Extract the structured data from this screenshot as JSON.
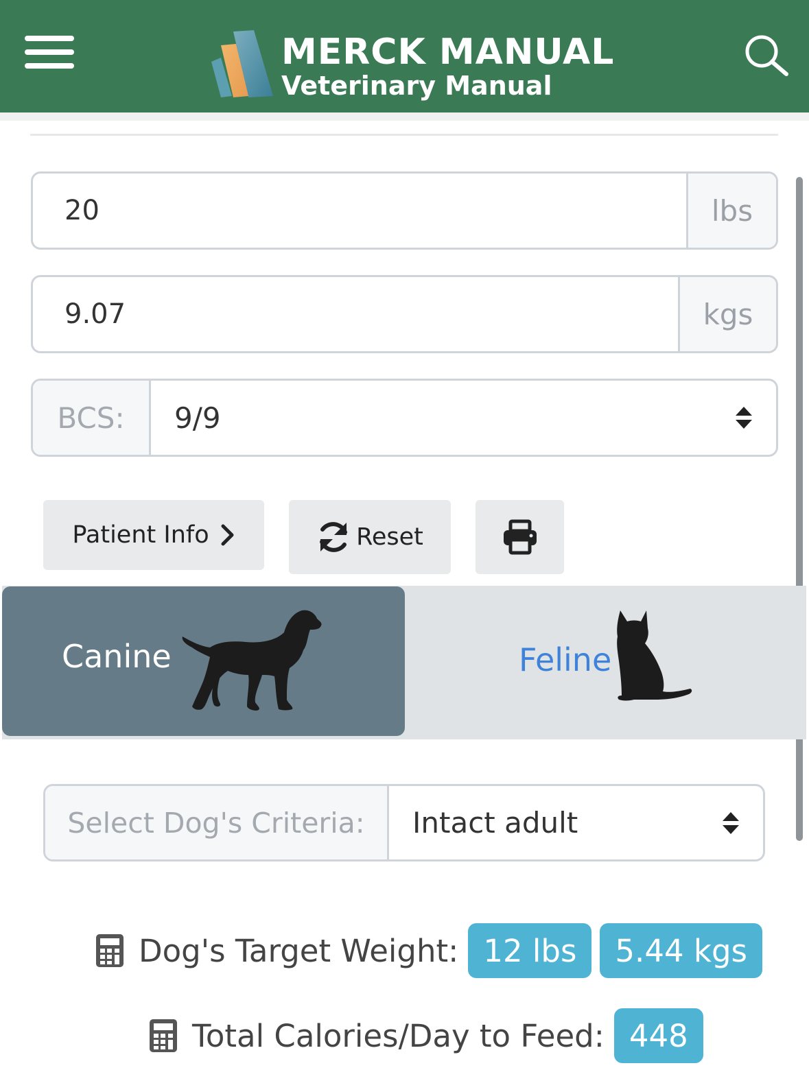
{
  "header": {
    "brand_title": "MERCK MANUAL",
    "brand_subtitle": "Veterinary Manual",
    "menu_icon": "hamburger-menu-icon",
    "search_icon": "search-icon"
  },
  "weight": {
    "lbs_value": "20",
    "lbs_unit": "lbs",
    "kgs_value": "9.07",
    "kgs_unit": "kgs"
  },
  "bcs": {
    "label": "BCS:",
    "selected": "9/9"
  },
  "actions": {
    "patient_info": "Patient Info",
    "reset": "Reset",
    "print_icon": "print-icon"
  },
  "species": {
    "canine": "Canine",
    "feline": "Feline",
    "selected": "Canine"
  },
  "criteria": {
    "label": "Select Dog's Criteria:",
    "selected": "Intact adult"
  },
  "results": {
    "target_weight_label": "Dog's Target Weight:",
    "target_weight_lbs": "12 lbs",
    "target_weight_kgs": "5.44 kgs",
    "calories_label": "Total Calories/Day to Feed:",
    "calories_value": "448"
  },
  "colors": {
    "header_bg": "#3a7b56",
    "selected_species_bg": "#657c88",
    "badge_bg": "#4fb4d4",
    "feline_text": "#3f82d9"
  }
}
